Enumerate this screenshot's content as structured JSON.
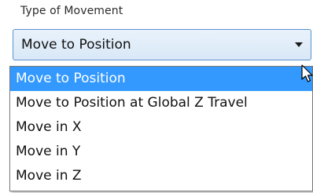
{
  "field": {
    "label": "Type of Movement",
    "selected_value": "Move to Position"
  },
  "dropdown": {
    "options": [
      {
        "label": "Move to Position",
        "selected": true
      },
      {
        "label": "Move to Position at Global Z Travel",
        "selected": false
      },
      {
        "label": "Move in X",
        "selected": false
      },
      {
        "label": "Move in Y",
        "selected": false
      },
      {
        "label": "Move in Z",
        "selected": false
      }
    ]
  },
  "colors": {
    "selection_highlight": "#3399ff",
    "combo_border": "#5b91cf",
    "combo_background": "#dce9f7"
  },
  "icons": {
    "dropdown_arrow": "chevron-down-icon",
    "cursor": "mouse-pointer-icon"
  }
}
